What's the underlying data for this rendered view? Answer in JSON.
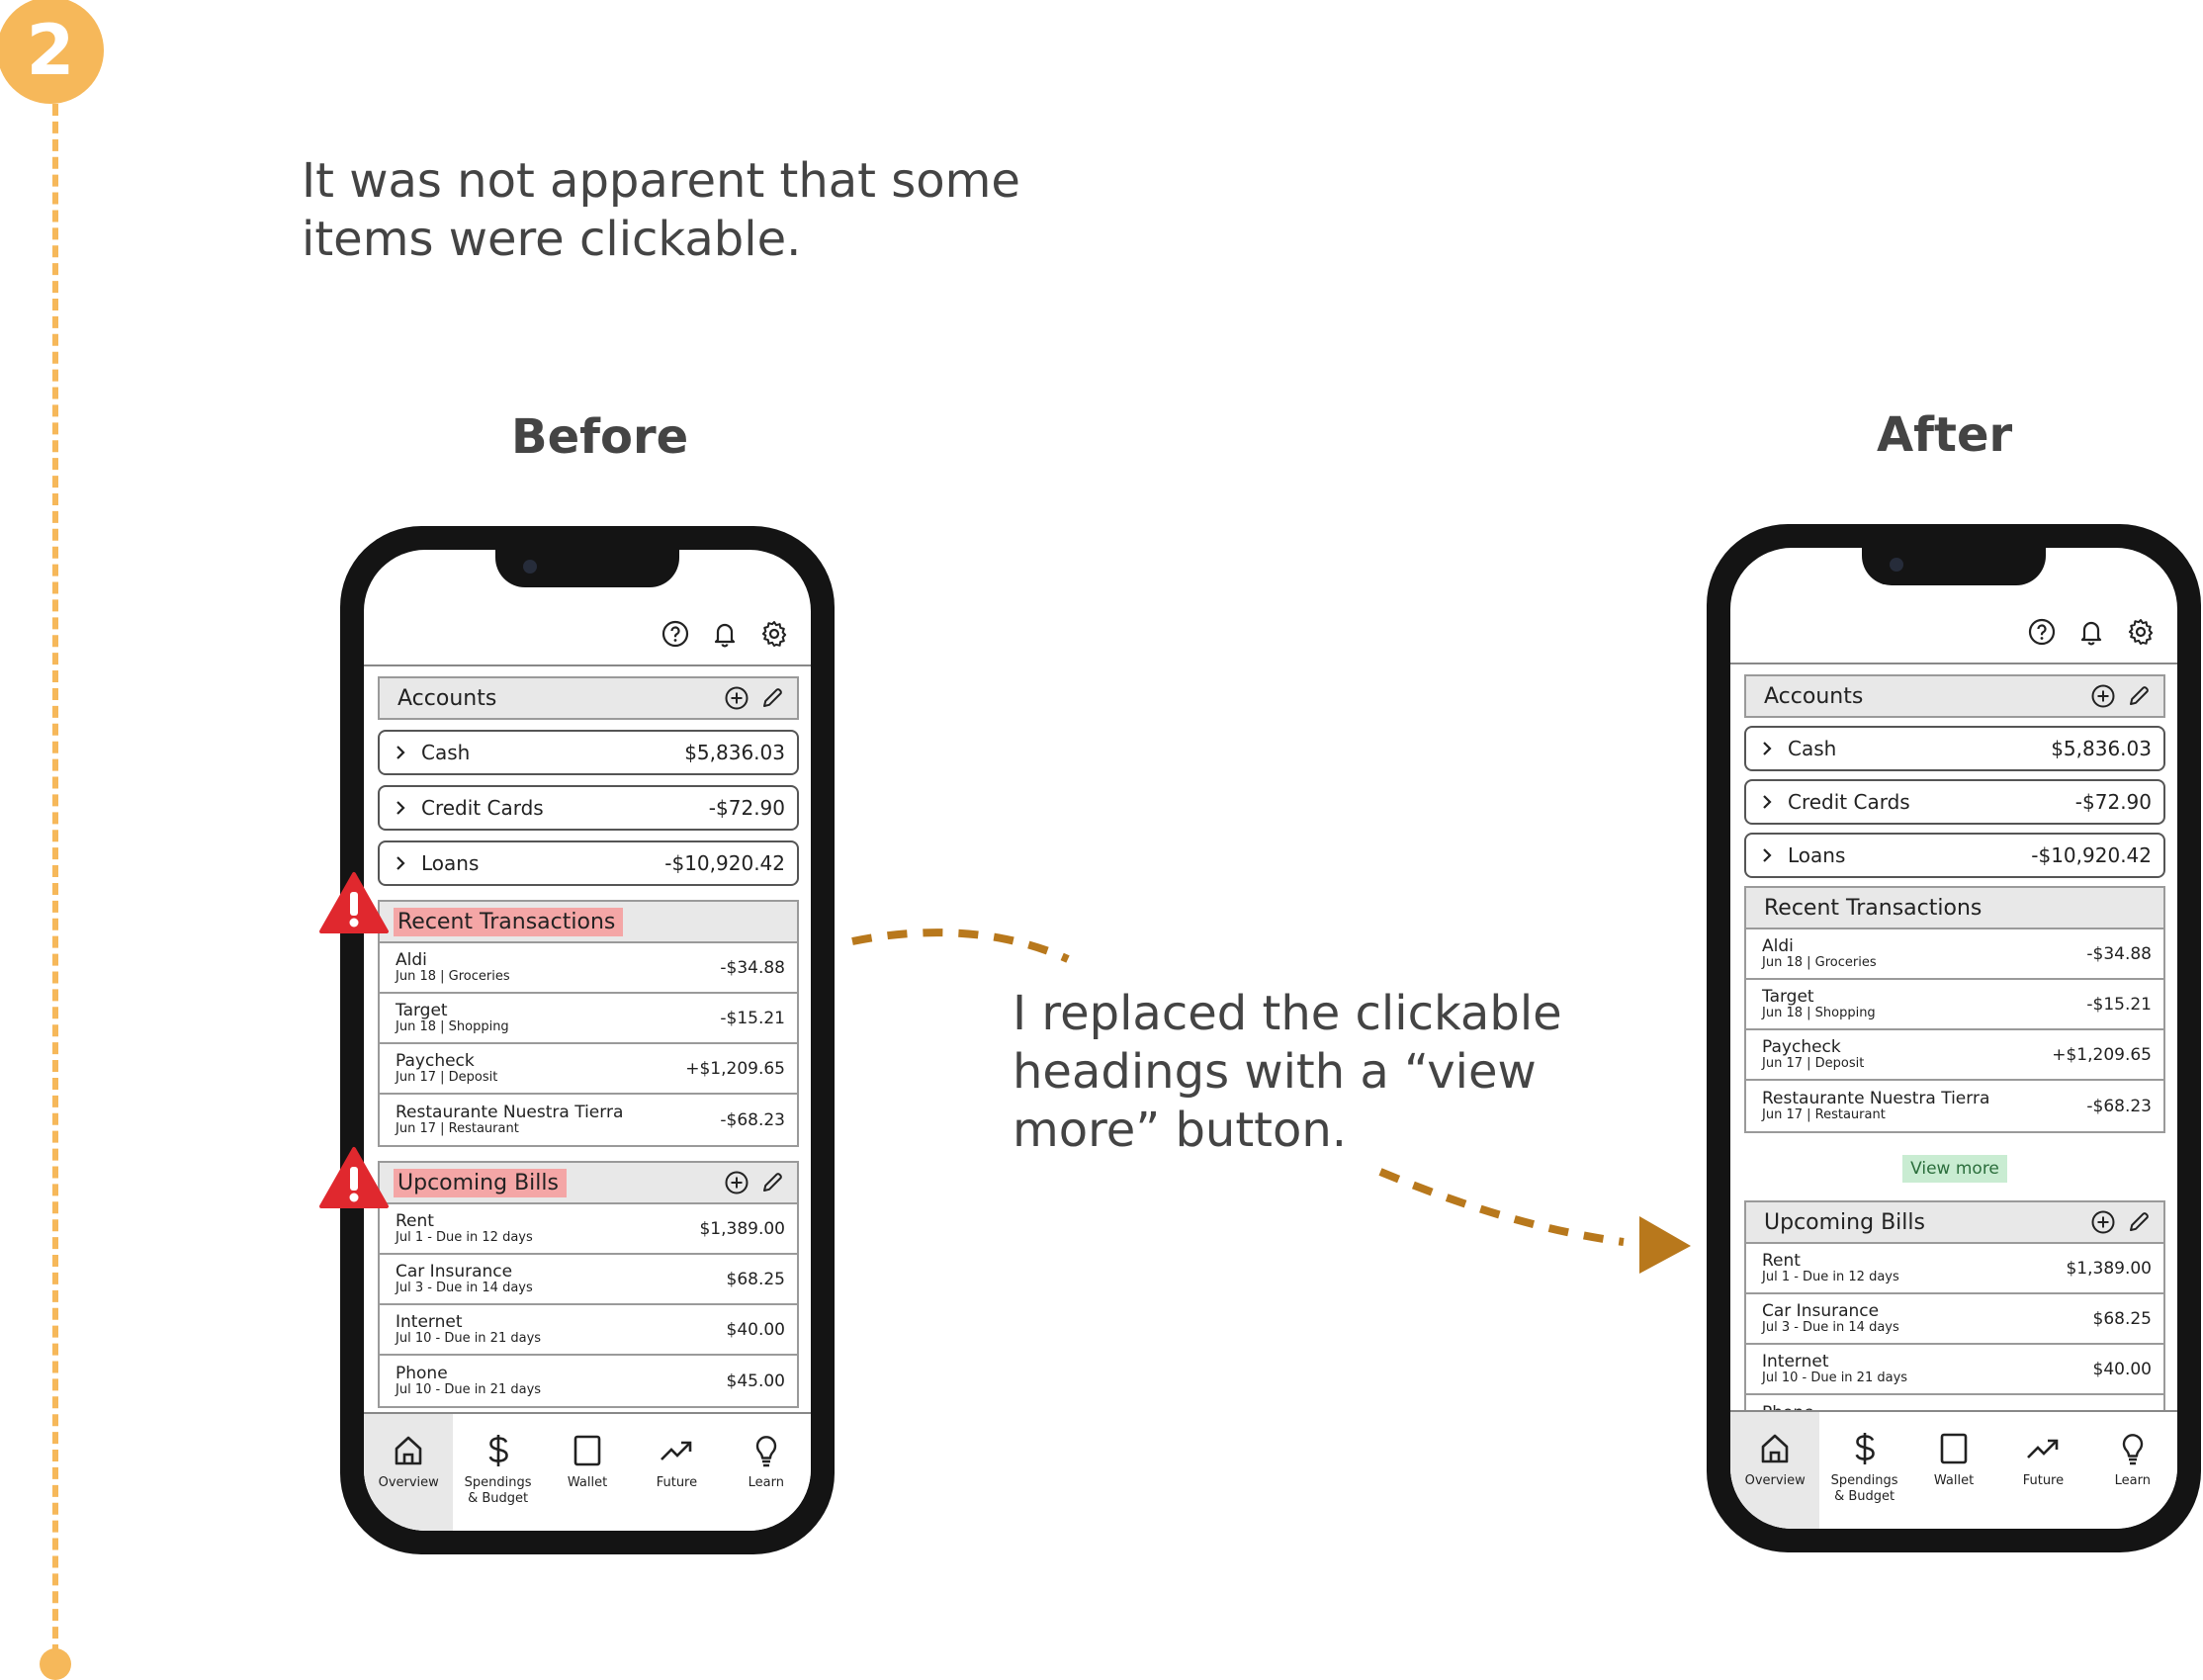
{
  "step_number": "2",
  "notes": {
    "problem": "It was not apparent that some items were clickable.",
    "solution": "I replaced the clickable headings with a “view more” button."
  },
  "headings": {
    "before": "Before",
    "after": "After"
  },
  "colors": {
    "accent": "#f6b85a",
    "arrow": "#b8781c",
    "highlight": "#f4a6a6",
    "warning": "#e0282e",
    "view_more_bg": "#c9ecd2"
  },
  "top_icons": [
    "help-icon",
    "bell-icon",
    "gear-icon"
  ],
  "accounts": {
    "title": "Accounts",
    "items": [
      {
        "name": "Cash",
        "amount": "$5,836.03"
      },
      {
        "name": "Credit Cards",
        "amount": "-$72.90"
      },
      {
        "name": "Loans",
        "amount": "-$10,920.42"
      }
    ]
  },
  "recent_transactions": {
    "title": "Recent Transactions",
    "items": [
      {
        "name": "Aldi",
        "sub": "Jun 18 | Groceries",
        "amount": "-$34.88"
      },
      {
        "name": "Target",
        "sub": "Jun 18 | Shopping",
        "amount": "-$15.21"
      },
      {
        "name": "Paycheck",
        "sub": "Jun 17 | Deposit",
        "amount": "+$1,209.65"
      },
      {
        "name": "Restaurante Nuestra Tierra",
        "sub": "Jun 17 | Restaurant",
        "amount": "-$68.23"
      }
    ]
  },
  "view_more_label": "View more",
  "upcoming_bills": {
    "title": "Upcoming Bills",
    "items": [
      {
        "name": "Rent",
        "sub": "Jul 1 - Due in 12 days",
        "amount": "$1,389.00"
      },
      {
        "name": "Car Insurance",
        "sub": "Jul 3 - Due in 14 days",
        "amount": "$68.25"
      },
      {
        "name": "Internet",
        "sub": "Jul 10 - Due in 21 days",
        "amount": "$40.00"
      },
      {
        "name": "Phone",
        "sub": "Jul 10 - Due in 21 days",
        "amount": "$45.00"
      }
    ]
  },
  "tabs": [
    {
      "label": "Overview",
      "icon": "home-icon"
    },
    {
      "label": "Spendings\n& Budget",
      "icon": "dollar-icon"
    },
    {
      "label": "Wallet",
      "icon": "wallet-icon"
    },
    {
      "label": "Future",
      "icon": "trend-icon"
    },
    {
      "label": "Learn",
      "icon": "lightbulb-icon"
    }
  ]
}
